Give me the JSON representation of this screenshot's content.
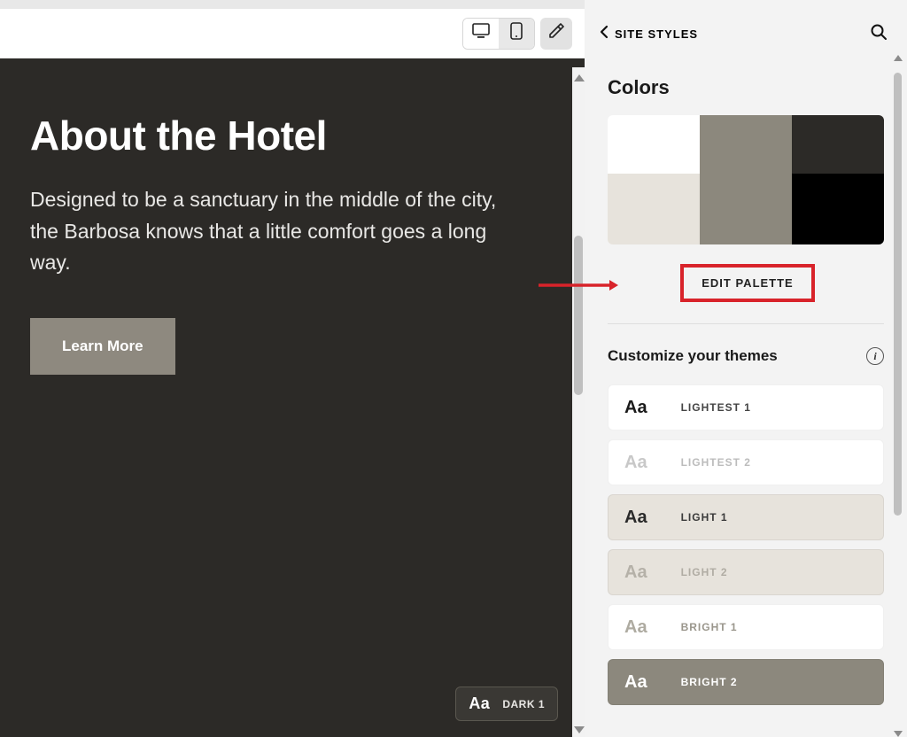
{
  "preview": {
    "hero_title": "About the Hotel",
    "hero_body": "Designed to be a sanctuary in the middle of the city, the Barbosa knows that a little comfort goes a long way.",
    "cta_label": "Learn More",
    "theme_badge": {
      "sample": "Aa",
      "name": "DARK 1"
    }
  },
  "sidebar": {
    "back_label": "SITE STYLES",
    "colors_title": "Colors",
    "palette": [
      "#ffffff",
      "#8c887d",
      "#2c2a27",
      "#e7e3dc",
      "#8c887d",
      "#000000"
    ],
    "edit_palette_label": "EDIT PALETTE",
    "customize_label": "Customize your themes",
    "themes": [
      {
        "sample": "Aa",
        "name": "LIGHTEST 1",
        "bg": "#ffffff",
        "fg": "#1a1a1a",
        "label_fg": "#444"
      },
      {
        "sample": "Aa",
        "name": "LIGHTEST 2",
        "bg": "#ffffff",
        "fg": "#c8c8c8",
        "label_fg": "#bcbcbc"
      },
      {
        "sample": "Aa",
        "name": "LIGHT 1",
        "bg": "#e7e3dc",
        "fg": "#2a2a2a",
        "label_fg": "#3a3a3a"
      },
      {
        "sample": "Aa",
        "name": "LIGHT 2",
        "bg": "#e7e3dc",
        "fg": "#b5b1a8",
        "label_fg": "#b0aca3"
      },
      {
        "sample": "Aa",
        "name": "BRIGHT 1",
        "bg": "#ffffff",
        "fg": "#aeaba1",
        "label_fg": "#9a968c"
      },
      {
        "sample": "Aa",
        "name": "BRIGHT 2",
        "bg": "#8c887d",
        "fg": "#ffffff",
        "label_fg": "#ffffff"
      }
    ]
  }
}
